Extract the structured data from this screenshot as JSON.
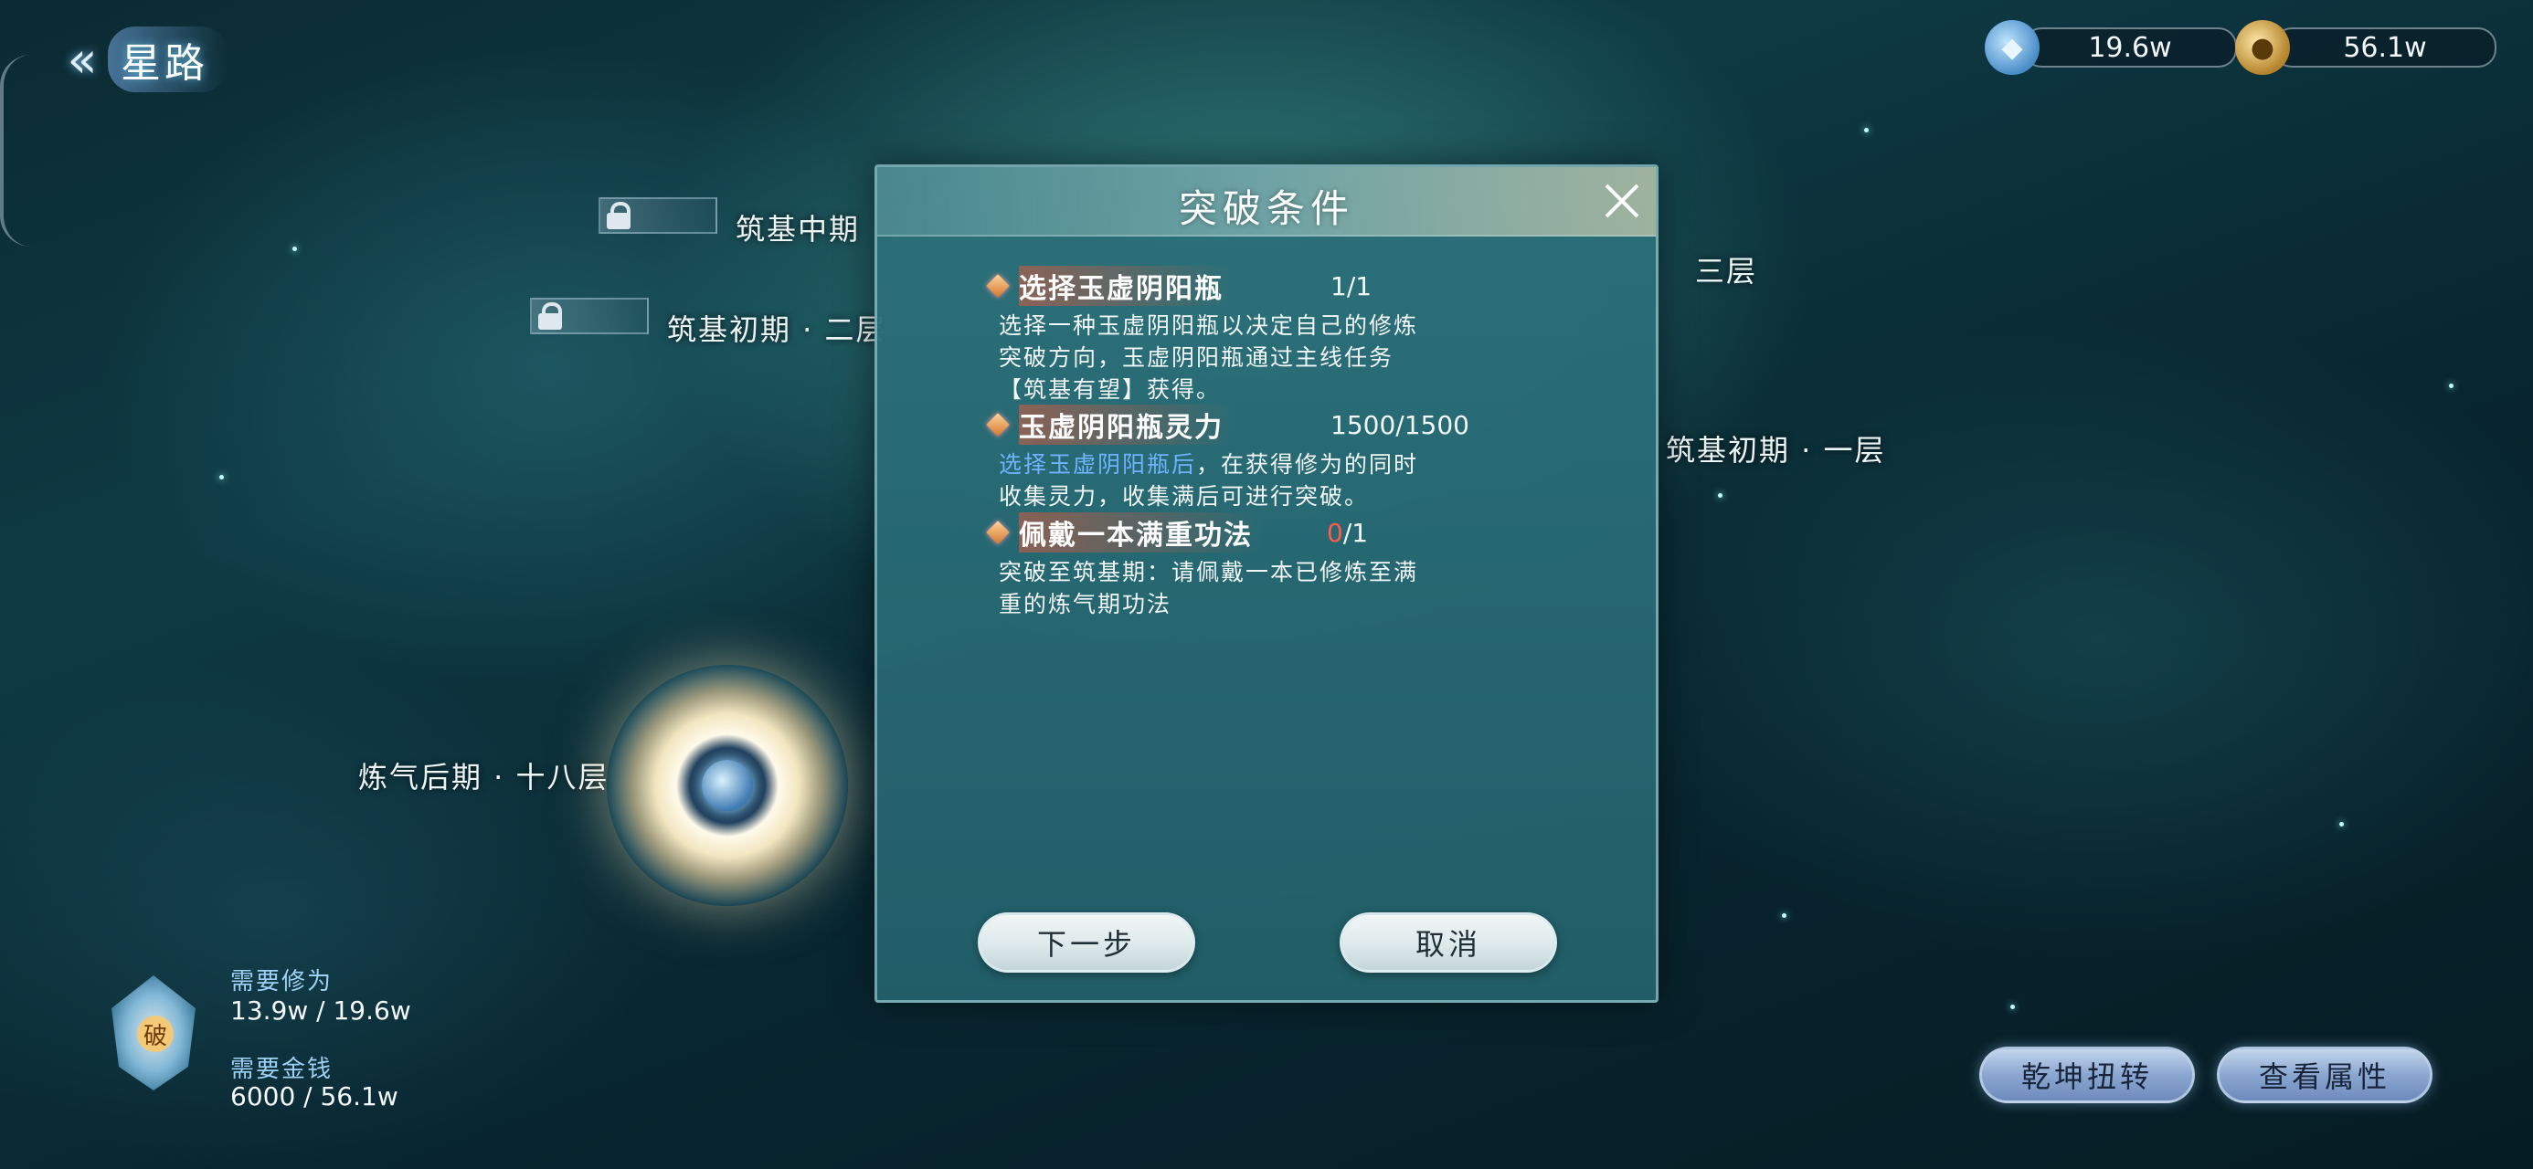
{
  "header": {
    "back_label": "星路",
    "currencies": [
      {
        "name": "xiuwei",
        "icon": "cultivation-crystal-icon",
        "value": "19.6w"
      },
      {
        "name": "gold",
        "icon": "gold-coin-icon",
        "value": "56.1w"
      }
    ]
  },
  "map": {
    "stages": [
      {
        "label": "筑基中期",
        "locked": true
      },
      {
        "label": "筑基初期 · 二层",
        "locked": true
      },
      {
        "label": "三层",
        "locked": false
      },
      {
        "label": "筑基初期 · 一层",
        "locked": false
      },
      {
        "label": "炼气后期 · 十八层",
        "locked": false,
        "current": true
      }
    ]
  },
  "dialog": {
    "title": "突破条件",
    "conditions": [
      {
        "name": "选择玉虚阴阳瓶",
        "progress": "1/1",
        "desc": "选择一种玉虚阴阳瓶以决定自己的修炼突破方向，玉虚阴阳瓶通过主线任务【筑基有望】获得。"
      },
      {
        "name": "玉虚阴阳瓶灵力",
        "progress": "1500/1500",
        "desc_link": "选择玉虚阴阳瓶后",
        "desc": "，在获得修为的同时收集灵力，收集满后可进行突破。"
      },
      {
        "name": "佩戴一本满重功法",
        "progress_current": "0",
        "progress_total": "/1",
        "desc": "突破至筑基期：请佩戴一本已修炼至满重的炼气期功法"
      }
    ],
    "next_label": "下一步",
    "cancel_label": "取消"
  },
  "requirements": {
    "icon_char": "破",
    "xiuwei_label": "需要修为",
    "xiuwei_value": "13.9w / 19.6w",
    "gold_label": "需要金钱",
    "gold_value": "6000 / 56.1w"
  },
  "actions": {
    "qiankun_label": "乾坤扭转",
    "attr_label": "查看属性"
  },
  "colors": {
    "link": "#6fb3ff",
    "insufficient": "#ff5a4a",
    "dialog_bg": "#2c707a"
  }
}
